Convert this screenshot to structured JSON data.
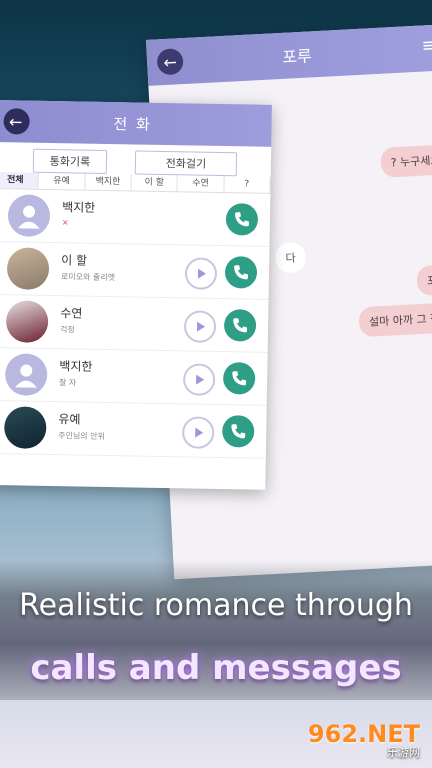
{
  "chat": {
    "title": "포루",
    "messages": [
      {
        "text": "? 누구세요",
        "side": "right"
      },
      {
        "text": "다",
        "side": "left"
      },
      {
        "text": "포루",
        "side": "right"
      },
      {
        "text": "설마 아까 그 작은녀석",
        "side": "right"
      }
    ]
  },
  "calls": {
    "title": "전 화",
    "tabs": {
      "history": "통화기록",
      "dial": "전화걸기"
    },
    "filters": [
      "전체",
      "유예",
      "백지한",
      "이 할",
      "수연",
      "?"
    ],
    "contacts": [
      {
        "name": "백지한",
        "sub": ""
      },
      {
        "name": "이 할",
        "sub": "로미오와 줄리엣"
      },
      {
        "name": "수연",
        "sub": "걱정"
      },
      {
        "name": "백지한",
        "sub": "잘 자"
      },
      {
        "name": "유예",
        "sub": "주인님의 안위"
      }
    ]
  },
  "banner": {
    "line1": "Realistic romance through",
    "line2": "calls and messages"
  },
  "watermark": {
    "main": "962.NET",
    "sub": "乐游网"
  },
  "colors": {
    "accent": "#9a9ad8",
    "call_green": "#2e9e86",
    "bubble_pink": "#f3cfd2"
  }
}
